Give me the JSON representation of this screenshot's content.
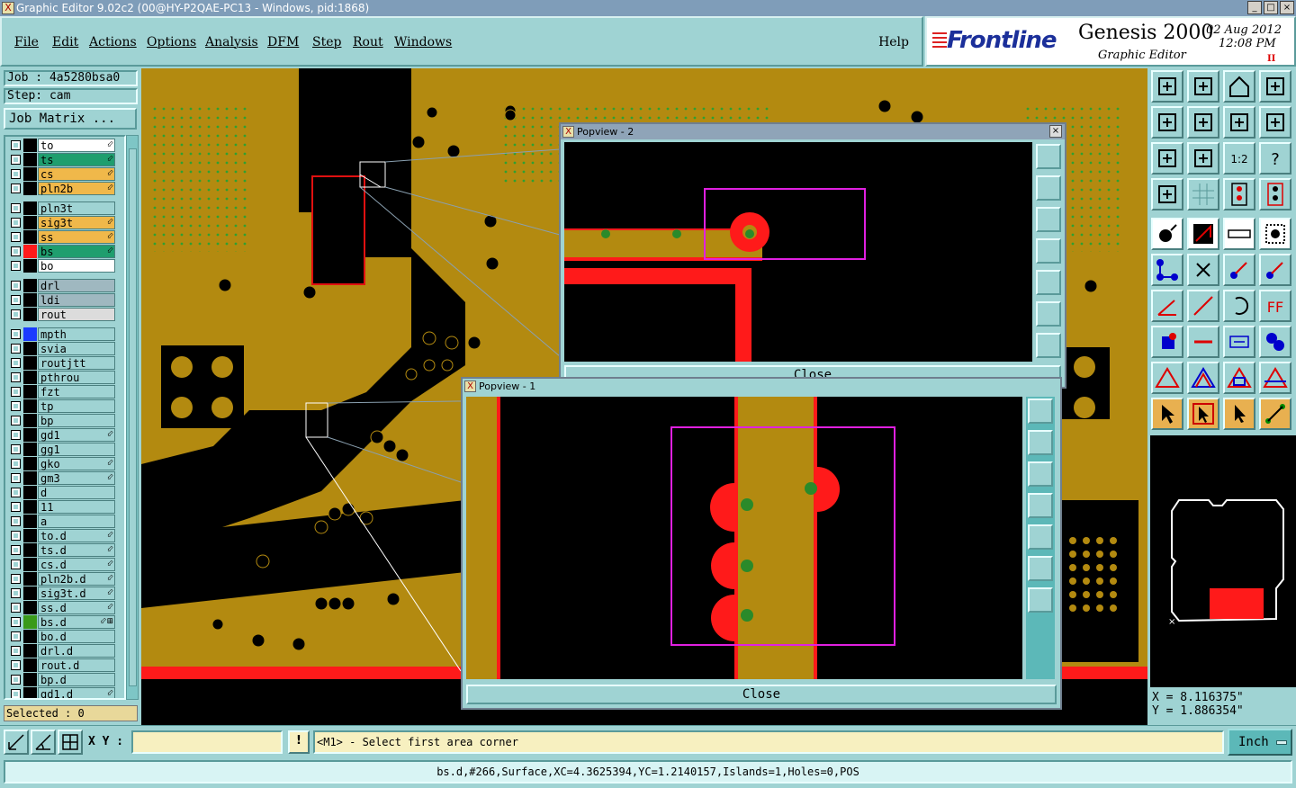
{
  "window": {
    "title": "Graphic Editor 9.02c2 (00@HY-P2QAE-PC13 - Windows, pid:1868)",
    "minimize": "_",
    "maximize": "□",
    "close": "×"
  },
  "menu": {
    "items": [
      "File",
      "Edit",
      "Actions",
      "Options",
      "Analysis",
      "DFM",
      "Step",
      "Rout",
      "Windows"
    ],
    "help": "Help"
  },
  "logo": {
    "brand": "Frontline",
    "product": "Genesis 2000",
    "date": "02  Aug  2012",
    "time": "12:08  PM",
    "module": "Graphic Editor",
    "pause": "II"
  },
  "job": {
    "job_label": "Job : 4a5280bsa0",
    "step_label": "Step: cam",
    "matrix_button": "Job Matrix ..."
  },
  "layers": [
    {
      "name": "to",
      "color": "#ffffff",
      "flag": "⬃"
    },
    {
      "name": "ts",
      "color": "#1f9e6e",
      "flag": "⬃"
    },
    {
      "name": "cs",
      "color": "#f0b84a",
      "flag": "⬃"
    },
    {
      "name": "pln2b",
      "color": "#f0b84a",
      "flag": "⬃"
    },
    {
      "name": "pln3t",
      "color": "#9fd3d3",
      "flag": ""
    },
    {
      "name": "sig3t",
      "color": "#f0b84a",
      "flag": "⬃"
    },
    {
      "name": "ss",
      "color": "#f0b84a",
      "flag": "⬃"
    },
    {
      "name": "bs",
      "color": "#1f9e6e",
      "flag": "⬃",
      "swatch": "#ff1a1a"
    },
    {
      "name": "bo",
      "color": "#ffffff",
      "flag": ""
    },
    {
      "name": "drl",
      "color": "#9fb8c0",
      "flag": ""
    },
    {
      "name": "ldi",
      "color": "#9fb8c0",
      "flag": ""
    },
    {
      "name": "rout",
      "color": "#dcdcdc",
      "flag": ""
    },
    {
      "name": "mpth",
      "color": "#9fd3d3",
      "flag": "",
      "swatch": "#1a3cff"
    },
    {
      "name": "svia",
      "color": "#9fd3d3",
      "flag": ""
    },
    {
      "name": "routjtt",
      "color": "#9fd3d3",
      "flag": ""
    },
    {
      "name": "pthrou",
      "color": "#9fd3d3",
      "flag": ""
    },
    {
      "name": "fzt",
      "color": "#9fd3d3",
      "flag": ""
    },
    {
      "name": "tp",
      "color": "#9fd3d3",
      "flag": ""
    },
    {
      "name": "bp",
      "color": "#9fd3d3",
      "flag": ""
    },
    {
      "name": "gd1",
      "color": "#9fd3d3",
      "flag": "⬃"
    },
    {
      "name": "gg1",
      "color": "#9fd3d3",
      "flag": ""
    },
    {
      "name": "gko",
      "color": "#9fd3d3",
      "flag": "⬃"
    },
    {
      "name": "gm3",
      "color": "#9fd3d3",
      "flag": "⬃"
    },
    {
      "name": "d",
      "color": "#9fd3d3",
      "flag": ""
    },
    {
      "name": "11",
      "color": "#9fd3d3",
      "flag": ""
    },
    {
      "name": "a",
      "color": "#9fd3d3",
      "flag": ""
    },
    {
      "name": "to.d",
      "color": "#9fd3d3",
      "flag": "⬃"
    },
    {
      "name": "ts.d",
      "color": "#9fd3d3",
      "flag": "⬃"
    },
    {
      "name": "cs.d",
      "color": "#9fd3d3",
      "flag": "⬃"
    },
    {
      "name": "pln2b.d",
      "color": "#9fd3d3",
      "flag": "⬃"
    },
    {
      "name": "sig3t.d",
      "color": "#9fd3d3",
      "flag": "⬃"
    },
    {
      "name": "ss.d",
      "color": "#9fd3d3",
      "flag": "⬃"
    },
    {
      "name": "bs.d",
      "color": "#9fd3d3",
      "flag": "⬃⊞",
      "swatch": "#3a9a1a"
    },
    {
      "name": "bo.d",
      "color": "#9fd3d3",
      "flag": ""
    },
    {
      "name": "drl.d",
      "color": "#9fd3d3",
      "flag": ""
    },
    {
      "name": "rout.d",
      "color": "#9fd3d3",
      "flag": ""
    },
    {
      "name": "bp.d",
      "color": "#9fd3d3",
      "flag": ""
    },
    {
      "name": "gd1.d",
      "color": "#9fd3d3",
      "flag": "⬃"
    }
  ],
  "selected": "Selected : 0",
  "popview2": {
    "title": "Popview - 2",
    "close_label": "Close",
    "close_x": "×"
  },
  "popview1": {
    "title": "Popview - 1",
    "close_label": "Close"
  },
  "coords": {
    "x": "X = 8.116375\"",
    "y": "Y = 1.886354\""
  },
  "toolbox": {
    "icons": [
      "zoom-home-icon",
      "zoom-in-icon",
      "house-icon",
      "split-view-icon",
      "pan-left-icon",
      "pan-right-icon",
      "mirror-icon",
      "snap-s-icon",
      "fit-icon",
      "center-icon",
      "ratio-label-icon",
      "help-icon",
      "measure-icon",
      "grid-icon",
      "layers-stack-icon",
      "layers-stack-red-icon",
      "select-point-icon",
      "move-red-icon",
      "ruler-icon",
      "dotted-square-icon",
      "connect-nodes-icon",
      "cross-icon",
      "add-pad-icon",
      "add-line-icon",
      "angle-icon",
      "slash-line-icon",
      "arc-icon",
      "ff-icon",
      "node-icon",
      "minus-red-icon",
      "measure-bar-icon",
      "cluster-icon",
      "triangle-icon",
      "triangle-a-icon",
      "triangle-box-icon",
      "triangle-b-icon",
      "pointer-icon",
      "pointer-box-icon",
      "pointer-select-icon",
      "node-path-icon"
    ],
    "ratio_label": "1:2"
  },
  "commandline": {
    "xy_label": "X Y :",
    "xy_value": "",
    "info": "!",
    "prompt": "<M1> - Select first area corner",
    "units": "Inch"
  },
  "status": "bs.d,#266,Surface,XC=4.3625394,YC=1.2140157,Islands=1,Holes=0,POS",
  "colors": {
    "copper": "#b38a10",
    "board_black": "#000000",
    "red_layer": "#ff1a1a",
    "green_pad": "#2a8a2a",
    "highlight": "#e020e0",
    "panel": "#9fd3d3"
  }
}
